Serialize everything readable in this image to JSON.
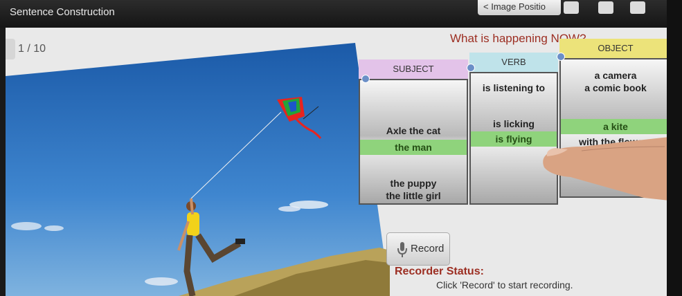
{
  "app": {
    "title": "Sentence Construction",
    "image_position_label": "< Image Positio"
  },
  "counter": "1 / 10",
  "question": "What is happening NOW?",
  "columns": {
    "subject": {
      "header": "SUBJECT",
      "header_color": "#e3c3e9",
      "above": [
        "Axle the cat"
      ],
      "selected": "the man",
      "below": [
        "the puppy",
        "the little girl"
      ]
    },
    "verb": {
      "header": "VERB",
      "header_color": "#bfe3ea",
      "above": [
        "is listening to",
        "is licking"
      ],
      "selected": "is flying",
      "below": []
    },
    "object": {
      "header": "OBJECT",
      "header_color": "#ece37a",
      "above": [
        "a camera",
        "a comic book"
      ],
      "selected": "a kite",
      "below": [
        "with the flowers"
      ]
    }
  },
  "record": {
    "label": "Record",
    "icon": "microphone-icon"
  },
  "recorder": {
    "title": "Recorder Status:",
    "message": "Click 'Record' to start recording."
  },
  "colors": {
    "selection": "#8fd37c",
    "question": "#9c2e22",
    "titlebar": "#1c1c1c"
  }
}
